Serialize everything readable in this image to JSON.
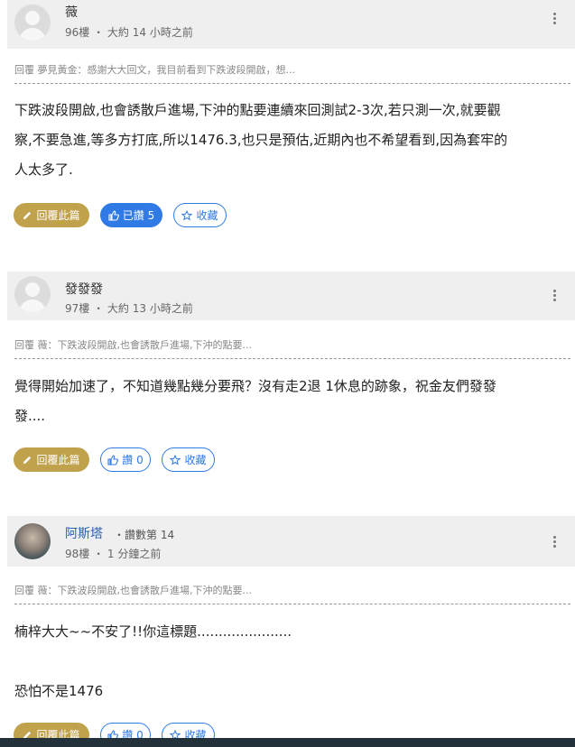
{
  "posts": [
    {
      "author": "薇",
      "rank": "",
      "floor": "96樓",
      "time": "大約 14 小時之前",
      "quote": "回覆 夢見黃金：感謝大大回文，我目前看到下跌波段開啟，想...",
      "content": [
        "下跌波段開啟,也會誘散戶進場,下沖的點要連續來回測試2-3次,若只測一次,就要觀",
        "察,不要急進,等多方打底,所以1476.3,也只是預估,近期內也不希望看到,因為套牢的",
        "人太多了."
      ],
      "reply_label": "回覆此篇",
      "like_label": "已讚 5",
      "fav_label": "收藏"
    },
    {
      "author": "發發發",
      "rank": "",
      "floor": "97樓",
      "time": "大約 13 小時之前",
      "quote": "回覆 薇：下跌波段開啟,也會誘散戶進場,下沖的點要...",
      "content": [
        "覺得開始加速了，不知道幾點幾分要飛？沒有走2退 1休息的跡象，祝金友們發發",
        "發...."
      ],
      "reply_label": "回覆此篇",
      "like_label": "讚 0",
      "fav_label": "收藏"
    },
    {
      "author": "阿斯塔",
      "rank": "・讚數第 14",
      "floor": "98樓",
      "time": "1 分鐘之前",
      "quote": "回覆 薇：下跌波段開啟,也會誘散戶進場,下沖的點要...",
      "content": [
        "楠梓大大~~不安了!!你這標題......................",
        "",
        "恐怕不是1476"
      ],
      "reply_label": "回覆此篇",
      "like_label": "讚 0",
      "fav_label": "收藏"
    }
  ],
  "colors": {
    "reply": "#c0a14c",
    "accent": "#2f7ae5"
  }
}
